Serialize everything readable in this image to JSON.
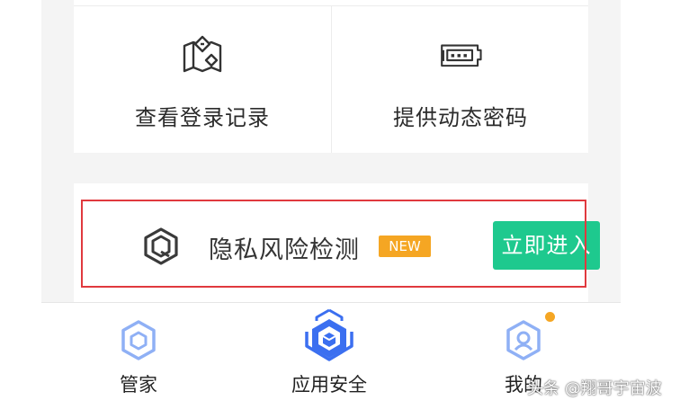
{
  "grid": {
    "items": [
      {
        "label": "查看登录记录",
        "icon": "login-record-icon"
      },
      {
        "label": "提供动态密码",
        "icon": "dynamic-password-icon"
      }
    ]
  },
  "privacy": {
    "title": "隐私风险检测",
    "badge": "NEW",
    "button_label": "立即进入",
    "icon": "privacy-shield-icon"
  },
  "tabbar": {
    "tabs": [
      {
        "label": "管家",
        "icon": "butler-hexagon-icon",
        "active": false
      },
      {
        "label": "应用安全",
        "icon": "app-security-shield-icon",
        "active": true
      },
      {
        "label": "我的",
        "icon": "profile-hexagon-icon",
        "active": false,
        "has_dot": true
      }
    ]
  },
  "watermark": "头条 @翔哥宇宙波",
  "colors": {
    "accent_green": "#1ec98e",
    "badge_orange": "#f5a623",
    "highlight_red": "#e0393e",
    "tab_blue": "#3b6ff0",
    "tab_blue_light": "#8fb0f5"
  }
}
